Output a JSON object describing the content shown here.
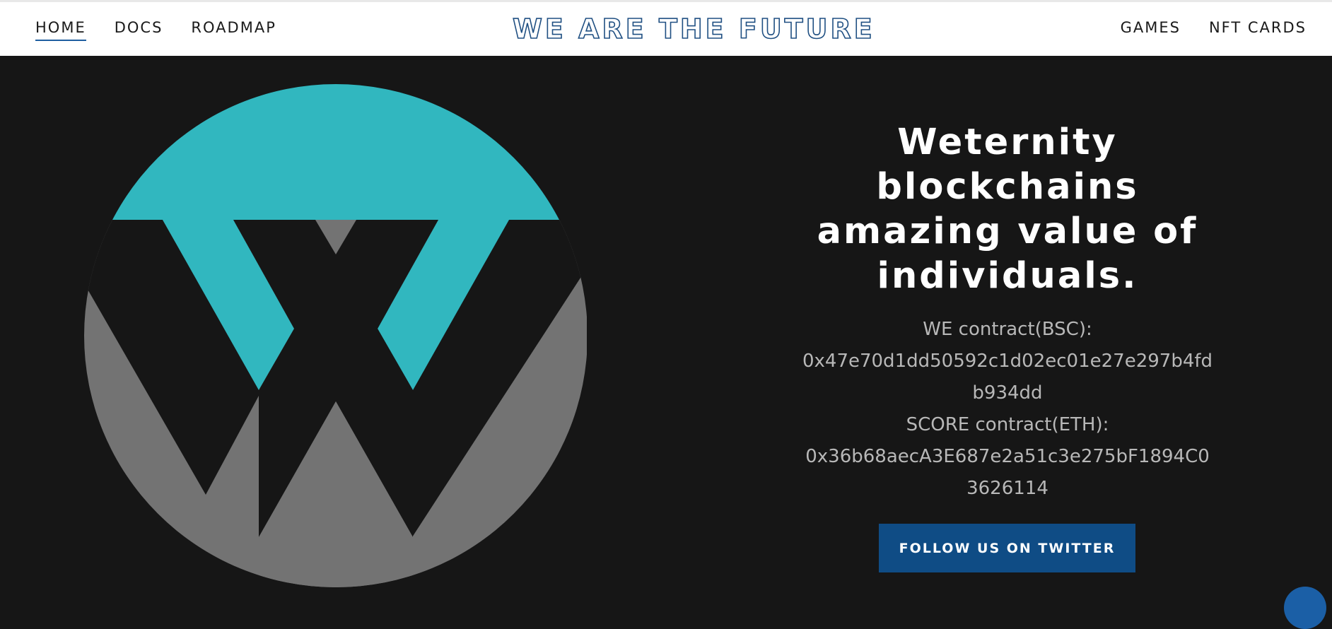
{
  "nav": {
    "left": [
      "HOME",
      "DOCS",
      "ROADMAP"
    ],
    "right": [
      "GAMES",
      "NFT CARDS"
    ],
    "active": "HOME",
    "accent_color": "#1f5fa0"
  },
  "site_title": "WE ARE THE FUTURE",
  "hero": {
    "headline_lines": [
      "Weternity",
      "blockchains",
      "amazing value of",
      "individuals."
    ],
    "we_contract_label": "WE contract(BSC):",
    "we_contract_line1": "0x47e70d1dd50592c1d02ec01e27e297b4fd",
    "we_contract_line2": "b934dd",
    "score_contract_label": "SCORE contract(ETH):",
    "score_contract_line1": "0x36b68aecA3E687e2a51c3e275bF1894C0",
    "score_contract_line2": "3626114",
    "twitter_button": "FOLLOW US ON TWITTER"
  },
  "colors": {
    "background": "#161616",
    "logo_teal": "#31b7bf",
    "logo_gray": "#737373",
    "button_blue": "#0f4c85"
  },
  "icons": {
    "logo": "weternity-w-logo-icon",
    "chat": "chat-bubble-icon"
  }
}
